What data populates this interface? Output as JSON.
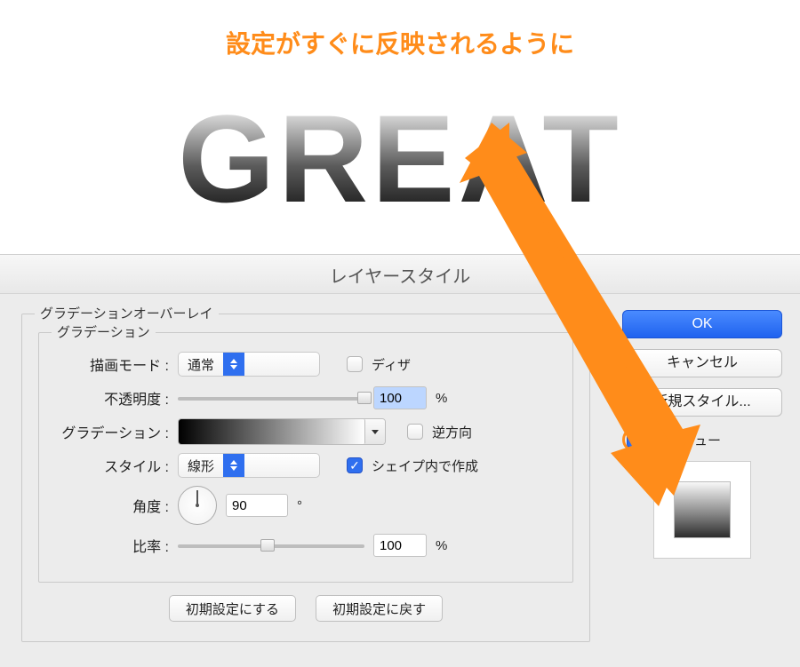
{
  "annotation_title": "設定がすぐに反映されるように",
  "preview_text": "GREAT",
  "dialog": {
    "title": "レイヤースタイル",
    "group_outer": "グラデーションオーバーレイ",
    "group_inner": "グラデーション",
    "blend_mode_label": "描画モード :",
    "blend_mode_value": "通常",
    "dither_label": "ディザ",
    "dither_checked": false,
    "opacity_label": "不透明度 :",
    "opacity_value": "100",
    "opacity_unit": "%",
    "gradient_label": "グラデーション :",
    "reverse_label": "逆方向",
    "reverse_checked": false,
    "style_label": "スタイル :",
    "style_value": "線形",
    "align_label": "シェイプ内で作成",
    "align_checked": true,
    "angle_label": "角度 :",
    "angle_value": "90",
    "angle_unit": "°",
    "scale_label": "比率 :",
    "scale_value": "100",
    "scale_unit": "%",
    "reset_default": "初期設定にする",
    "reset_revert": "初期設定に戻す"
  },
  "buttons": {
    "ok": "OK",
    "cancel": "キャンセル",
    "new_style": "新規スタイル...",
    "preview": "プレビュー",
    "preview_checked": true
  },
  "colors": {
    "accent_orange": "#ff8c1a",
    "accent_blue": "#2f6fef"
  }
}
